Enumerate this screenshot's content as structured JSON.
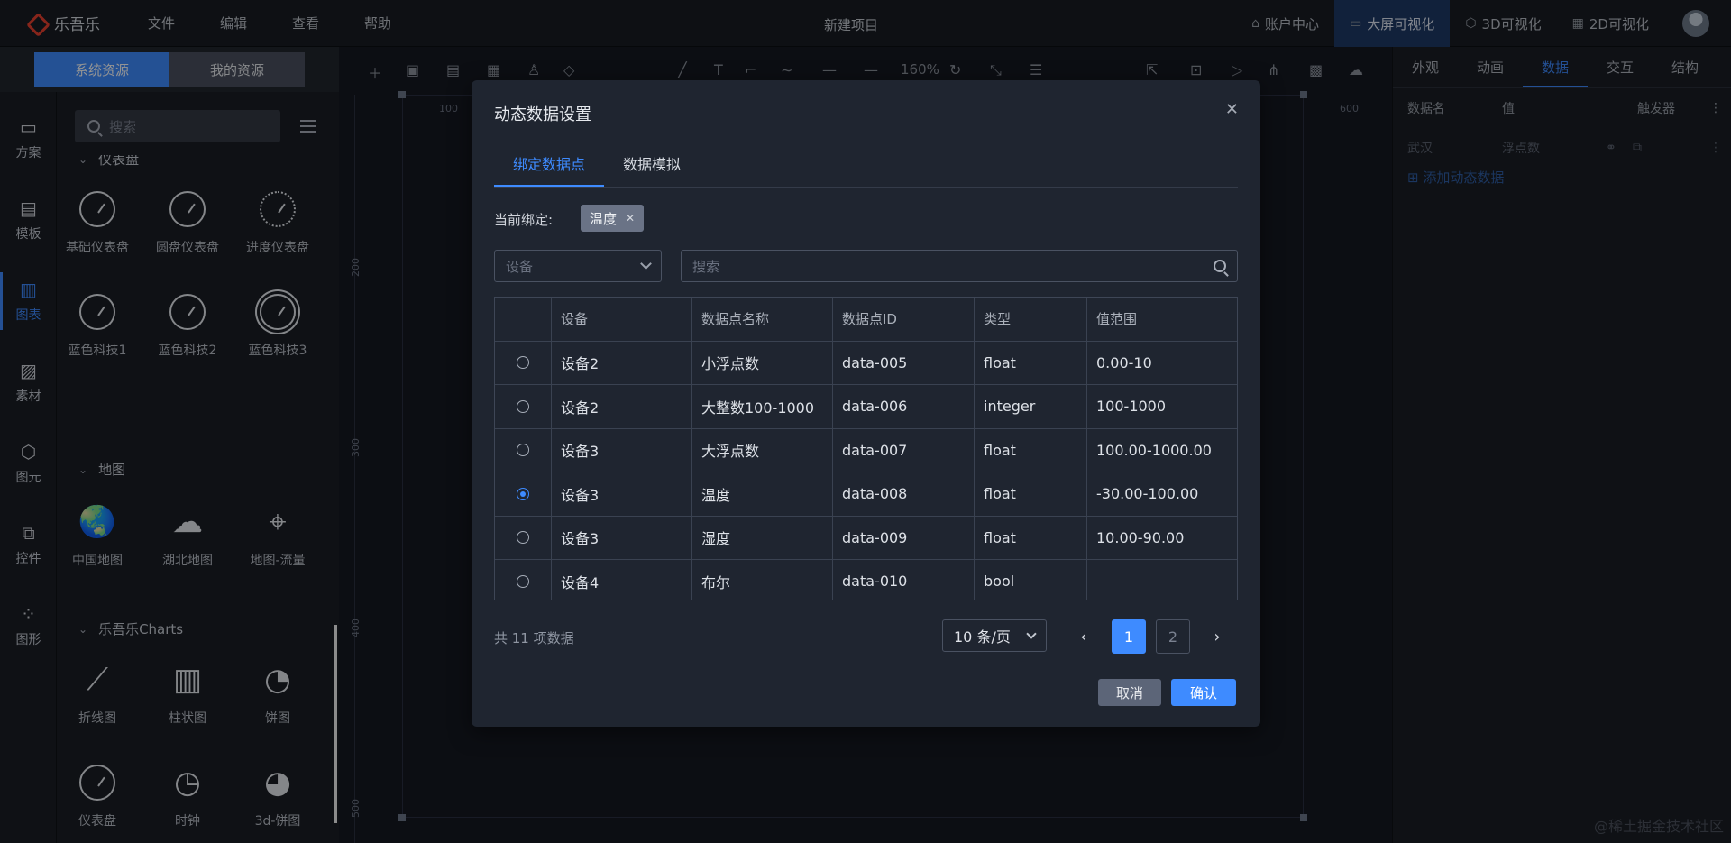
{
  "topbar": {
    "logo_text": "乐吾乐",
    "menu": [
      "文件",
      "编辑",
      "查看",
      "帮助"
    ],
    "project_title": "新建项目",
    "nav": [
      {
        "label": "账户中心",
        "icon": "home-icon",
        "active": false
      },
      {
        "label": "大屏可视化",
        "icon": "monitor-icon",
        "active": true
      },
      {
        "label": "3D可视化",
        "icon": "cube-icon",
        "active": false
      },
      {
        "label": "2D可视化",
        "icon": "grid-icon",
        "active": false
      }
    ]
  },
  "rail": {
    "items": [
      {
        "label": "方案",
        "icon": "monitor-icon"
      },
      {
        "label": "模板",
        "icon": "template-icon"
      },
      {
        "label": "图表",
        "icon": "chart-icon"
      },
      {
        "label": "素材",
        "icon": "image-icon"
      },
      {
        "label": "图元",
        "icon": "cube-icon"
      },
      {
        "label": "控件",
        "icon": "widget-icon"
      },
      {
        "label": "图形",
        "icon": "scatter-icon"
      }
    ],
    "active_index": 2
  },
  "resources": {
    "tabs": [
      "系统资源",
      "我的资源"
    ],
    "active_tab": 0,
    "search_placeholder": "搜索",
    "sections": [
      {
        "title": "仪表盘",
        "items": [
          "基础仪表盘",
          "圆盘仪表盘",
          "进度仪表盘",
          "蓝色科技1",
          "蓝色科技2",
          "蓝色科技3"
        ]
      },
      {
        "title": "地图",
        "items": [
          "中国地图",
          "湖北地图",
          "地图-流量"
        ]
      },
      {
        "title": "乐吾乐Charts",
        "items": [
          "折线图",
          "柱状图",
          "饼图",
          "仪表盘",
          "时钟",
          "3d-饼图"
        ]
      }
    ]
  },
  "canvas": {
    "zoom": "160%",
    "ruler_top": [
      "100",
      "600"
    ],
    "ruler_left": [
      "200",
      "300",
      "400",
      "500"
    ]
  },
  "right_panel": {
    "tabs": [
      "外观",
      "动画",
      "数据",
      "交互",
      "结构"
    ],
    "active_tab": 2,
    "headers": [
      "数据名",
      "值",
      "触发器"
    ],
    "row": {
      "name": "武汉",
      "value": "浮点数"
    },
    "add_label": "添加动态数据"
  },
  "modal": {
    "title": "动态数据设置",
    "tabs": [
      "绑定数据点",
      "数据模拟"
    ],
    "active_tab": 0,
    "current_binding_label": "当前绑定:",
    "current_binding_tag": "温度",
    "device_placeholder": "设备",
    "search_placeholder": "搜索",
    "table": {
      "headers": [
        "设备",
        "数据点名称",
        "数据点ID",
        "类型",
        "值范围"
      ],
      "rows": [
        {
          "device": "设备2",
          "name": "小浮点数",
          "id": "data-005",
          "type": "float",
          "range": "0.00-10",
          "selected": false
        },
        {
          "device": "设备2",
          "name": "大整数100-1000",
          "id": "data-006",
          "type": "integer",
          "range": "100-1000",
          "selected": false
        },
        {
          "device": "设备3",
          "name": "大浮点数",
          "id": "data-007",
          "type": "float",
          "range": "100.00-1000.00",
          "selected": false
        },
        {
          "device": "设备3",
          "name": "温度",
          "id": "data-008",
          "type": "float",
          "range": "-30.00-100.00",
          "selected": true
        },
        {
          "device": "设备3",
          "name": "湿度",
          "id": "data-009",
          "type": "float",
          "range": "10.00-90.00",
          "selected": false
        },
        {
          "device": "设备4",
          "name": "布尔",
          "id": "data-010",
          "type": "bool",
          "range": "",
          "selected": false
        }
      ]
    },
    "total_text": "共 11 项数据",
    "page_size": "10 条/页",
    "pages": [
      "1",
      "2"
    ],
    "current_page": "1",
    "cancel_label": "取消",
    "ok_label": "确认"
  },
  "watermark": "@稀土掘金技术社区",
  "colors": {
    "accent": "#3e8bff",
    "background": "#161a22",
    "panel": "#1a1e25",
    "modal": "#1f2530",
    "logo": "#e8412f"
  }
}
